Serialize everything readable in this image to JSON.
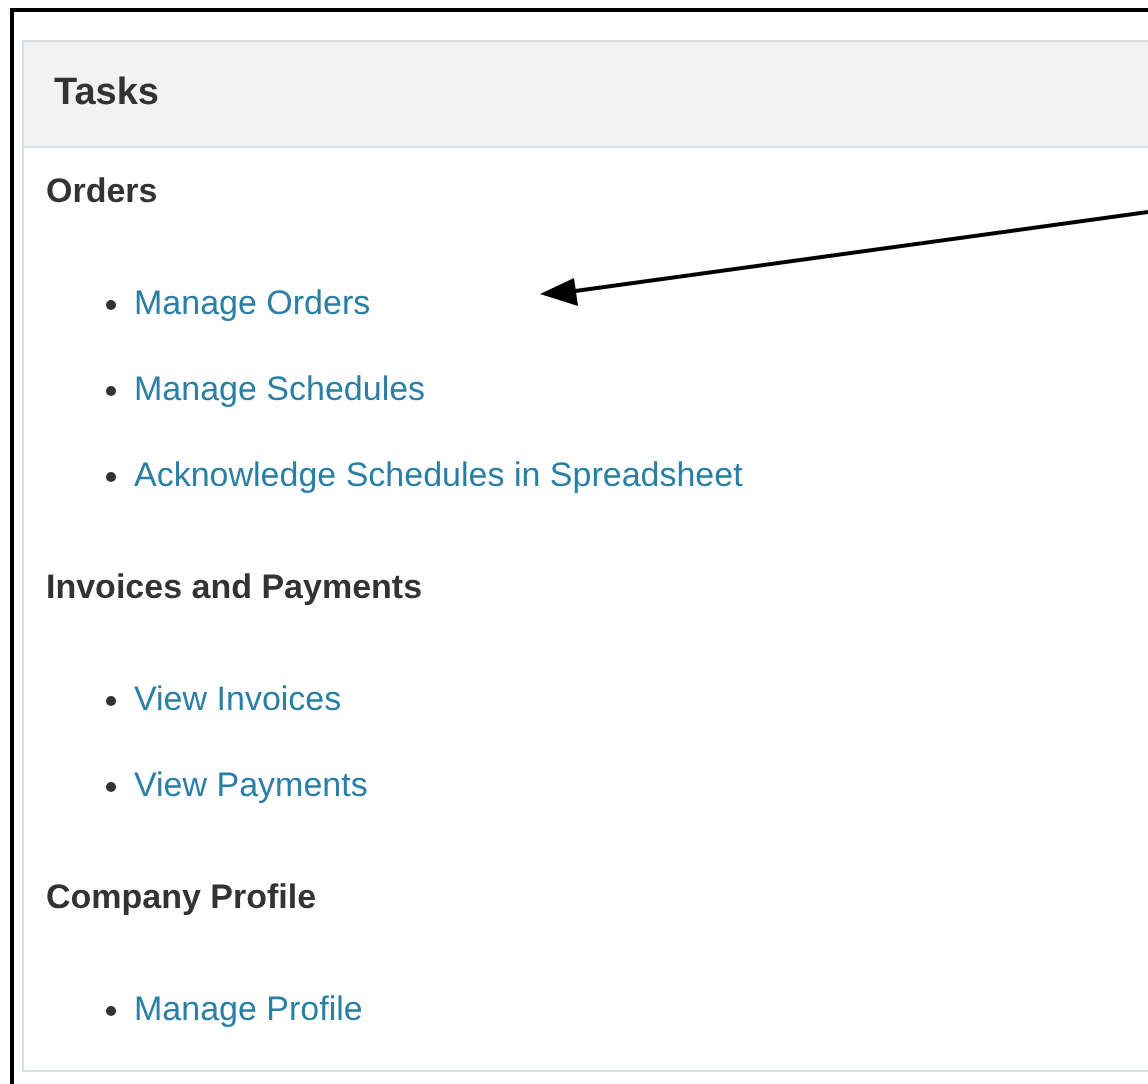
{
  "panel": {
    "title": "Tasks"
  },
  "sections": [
    {
      "heading": "Orders",
      "links": [
        "Manage Orders",
        "Manage Schedules",
        "Acknowledge Schedules in Spreadsheet"
      ]
    },
    {
      "heading": "Invoices and Payments",
      "links": [
        "View Invoices",
        "View Payments"
      ]
    },
    {
      "heading": "Company Profile",
      "links": [
        "Manage Profile"
      ]
    }
  ]
}
